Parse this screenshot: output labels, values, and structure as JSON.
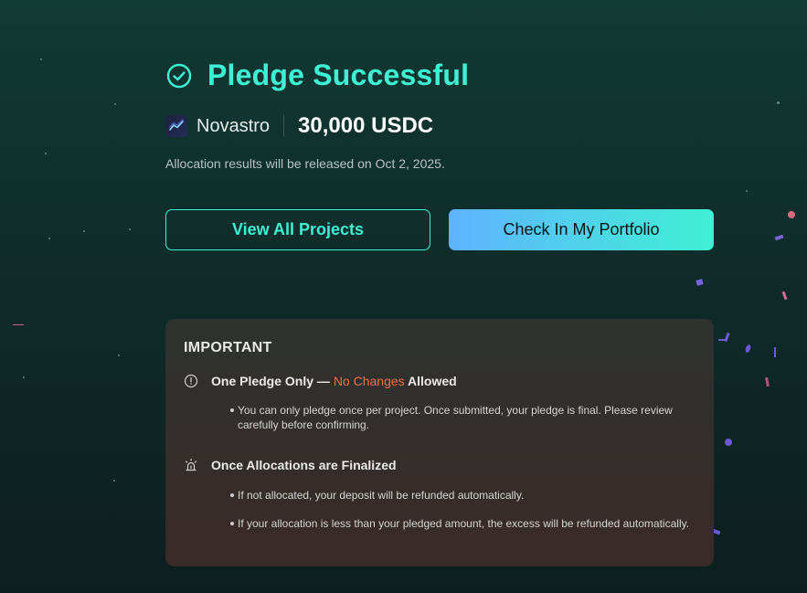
{
  "header": {
    "title": "Pledge Successful",
    "icon": "check-circle-icon",
    "accent": "#3ff1d3"
  },
  "project": {
    "name": "Novastro",
    "amount": "30,000 USDC",
    "logo_icon": "trend-line-icon"
  },
  "release_note": "Allocation results will be released on Oct 2, 2025.",
  "buttons": {
    "view_all": "View All Projects",
    "portfolio": "Check In My Portfolio"
  },
  "important": {
    "title": "IMPORTANT",
    "one_pledge": {
      "icon": "alert-circle-icon",
      "prefix": "One Pledge Only — ",
      "highlight": "No Changes",
      "suffix": " Allowed",
      "highlight_color": "#f0704c",
      "bullets": [
        "You can only pledge once per project. Once submitted, your pledge is final. Please review carefully before confirming."
      ]
    },
    "finalized": {
      "icon": "alarm-icon",
      "title": "Once Allocations are Finalized",
      "bullets": [
        "If not allocated, your deposit will be refunded automatically.",
        "If your allocation is less than your pledged amount, the excess will be refunded automatically."
      ]
    }
  }
}
